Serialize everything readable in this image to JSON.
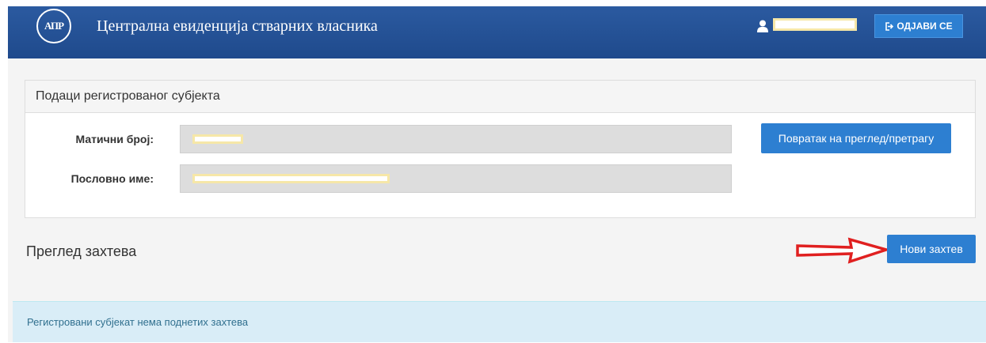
{
  "header": {
    "logo_text": "АПР",
    "title": "Централна евиденција стварних власника",
    "logout_label": "ОДЈАВИ СЕ"
  },
  "panel": {
    "heading": "Подаци регистрованог субјекта",
    "fields": [
      {
        "label": "Матични број:"
      },
      {
        "label": "Пословно име:"
      }
    ],
    "back_button": "Повратак на преглед/претрагу"
  },
  "requests": {
    "title": "Преглед захтева",
    "new_button": "Нови захтев",
    "empty_message": "Регистровани субјекат нема поднетих захтева"
  },
  "colors": {
    "header": "#1f4a8c",
    "button": "#2d7fd1",
    "alert_bg": "#d9edf7",
    "annotation_arrow": "#e02020"
  }
}
